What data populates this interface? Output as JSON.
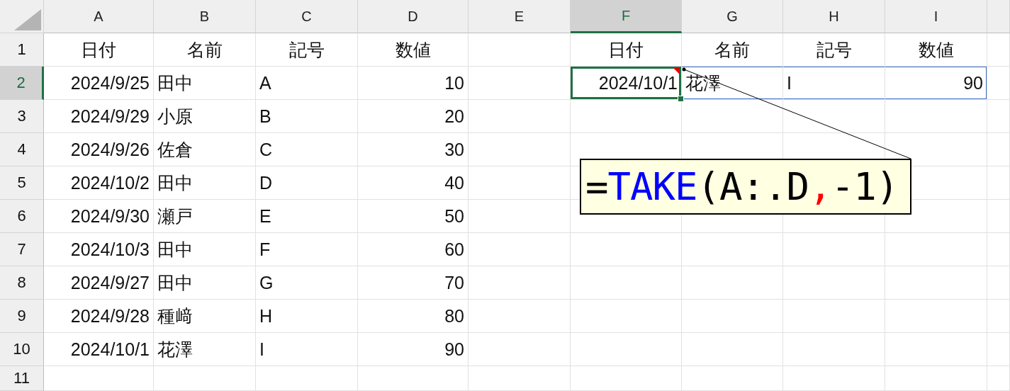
{
  "columns": [
    {
      "label": "A",
      "selected": false
    },
    {
      "label": "B",
      "selected": false
    },
    {
      "label": "C",
      "selected": false
    },
    {
      "label": "D",
      "selected": false
    },
    {
      "label": "E",
      "selected": false
    },
    {
      "label": "F",
      "selected": true
    },
    {
      "label": "G",
      "selected": false
    },
    {
      "label": "H",
      "selected": false
    },
    {
      "label": "I",
      "selected": false
    }
  ],
  "rows": [
    {
      "label": "1",
      "selected": false,
      "cells": [
        {
          "value": "日付",
          "kind": "heading"
        },
        {
          "value": "名前",
          "kind": "heading"
        },
        {
          "value": "記号",
          "kind": "heading"
        },
        {
          "value": "数値",
          "kind": "heading"
        },
        null,
        {
          "value": "日付",
          "kind": "heading"
        },
        {
          "value": "名前",
          "kind": "heading"
        },
        {
          "value": "記号",
          "kind": "heading"
        },
        {
          "value": "数値",
          "kind": "heading"
        }
      ]
    },
    {
      "label": "2",
      "selected": true,
      "cells": [
        {
          "value": "2024/9/25",
          "kind": "number"
        },
        {
          "value": "田中",
          "kind": "text"
        },
        {
          "value": "A",
          "kind": "text"
        },
        {
          "value": "10",
          "kind": "number"
        },
        null,
        {
          "value": "2024/10/1",
          "kind": "number",
          "selected": true,
          "spill": true,
          "has_comment": true
        },
        {
          "value": "花澤",
          "kind": "text",
          "selected": false,
          "spill": true
        },
        {
          "value": "I",
          "kind": "text",
          "selected": false,
          "spill": true
        },
        {
          "value": "90",
          "kind": "number",
          "selected": false,
          "spill": true
        }
      ]
    },
    {
      "label": "3",
      "selected": false,
      "cells": [
        {
          "value": "2024/9/29",
          "kind": "number"
        },
        {
          "value": "小原",
          "kind": "text"
        },
        {
          "value": "B",
          "kind": "text"
        },
        {
          "value": "20",
          "kind": "number"
        }
      ]
    },
    {
      "label": "4",
      "selected": false,
      "cells": [
        {
          "value": "2024/9/26",
          "kind": "number"
        },
        {
          "value": "佐倉",
          "kind": "text"
        },
        {
          "value": "C",
          "kind": "text"
        },
        {
          "value": "30",
          "kind": "number"
        }
      ]
    },
    {
      "label": "5",
      "selected": false,
      "cells": [
        {
          "value": "2024/10/2",
          "kind": "number"
        },
        {
          "value": "田中",
          "kind": "text"
        },
        {
          "value": "D",
          "kind": "text"
        },
        {
          "value": "40",
          "kind": "number"
        }
      ]
    },
    {
      "label": "6",
      "selected": false,
      "cells": [
        {
          "value": "2024/9/30",
          "kind": "number"
        },
        {
          "value": "瀬戸",
          "kind": "text"
        },
        {
          "value": "E",
          "kind": "text"
        },
        {
          "value": "50",
          "kind": "number"
        }
      ]
    },
    {
      "label": "7",
      "selected": false,
      "cells": [
        {
          "value": "2024/10/3",
          "kind": "number"
        },
        {
          "value": "田中",
          "kind": "text"
        },
        {
          "value": "F",
          "kind": "text"
        },
        {
          "value": "60",
          "kind": "number"
        }
      ]
    },
    {
      "label": "8",
      "selected": false,
      "cells": [
        {
          "value": "2024/9/27",
          "kind": "number"
        },
        {
          "value": "田中",
          "kind": "text"
        },
        {
          "value": "G",
          "kind": "text"
        },
        {
          "value": "70",
          "kind": "number"
        }
      ]
    },
    {
      "label": "9",
      "selected": false,
      "cells": [
        {
          "value": "2024/9/28",
          "kind": "number"
        },
        {
          "value": "種﨑",
          "kind": "text"
        },
        {
          "value": "H",
          "kind": "text"
        },
        {
          "value": "80",
          "kind": "number"
        }
      ]
    },
    {
      "label": "10",
      "selected": false,
      "cells": [
        {
          "value": "2024/10/1",
          "kind": "number"
        },
        {
          "value": "花澤",
          "kind": "text"
        },
        {
          "value": "I",
          "kind": "text"
        },
        {
          "value": "90",
          "kind": "number"
        }
      ]
    },
    {
      "label": "11",
      "selected": false,
      "cells": []
    }
  ],
  "comment": {
    "segments": [
      {
        "text": "=",
        "color": "#000000"
      },
      {
        "text": "TAKE",
        "color": "#0000ff"
      },
      {
        "text": "(A:.D",
        "color": "#000000"
      },
      {
        "text": ",",
        "color": "#ff0000"
      },
      {
        "text": "-1)",
        "color": "#000000"
      }
    ]
  }
}
